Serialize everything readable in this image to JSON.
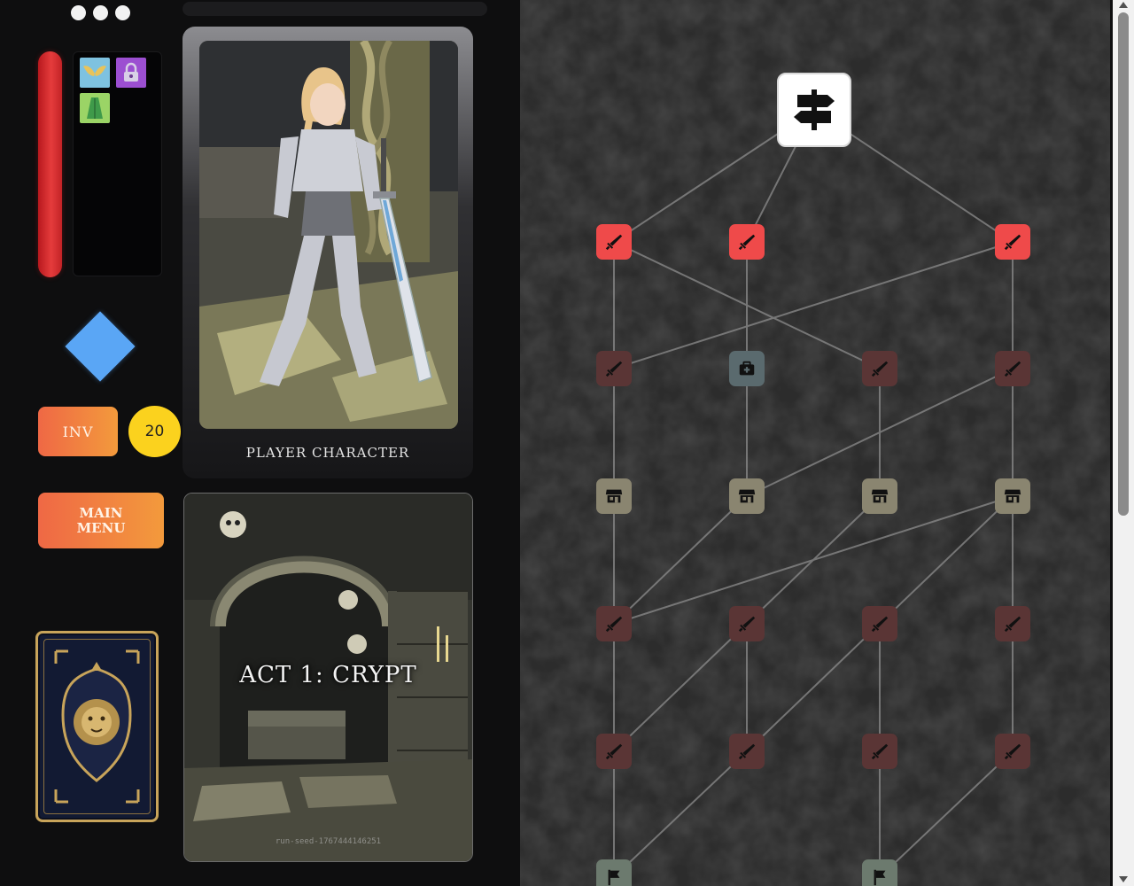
{
  "hud": {
    "inventory_label": "INV",
    "gold": "20",
    "main_menu_label": "MAIN\nMENU",
    "relics": [
      "wings-icon",
      "padlock-icon",
      "cloak-icon"
    ]
  },
  "character": {
    "label": "PLAYER CHARACTER"
  },
  "act": {
    "title": "ACT 1: CRYPT",
    "seed": "run-seed-1767444146251"
  },
  "map": {
    "boss_icon": "signpost-icon",
    "colors": {
      "combat_active": "#ef4a4a",
      "combat": "#5a3535",
      "rest": "#5a6a6e",
      "shop": "#8a8570",
      "end": "#6c7a6e",
      "path": "#8c8c8c"
    },
    "rows": [
      [
        "combat_active",
        "combat_active",
        null,
        "combat_active"
      ],
      [
        "combat",
        "rest",
        "combat",
        "combat"
      ],
      [
        "shop",
        "shop",
        "shop",
        "shop"
      ],
      [
        "combat",
        "combat",
        "combat",
        "combat"
      ],
      [
        "combat",
        "combat",
        "combat",
        "combat"
      ],
      [
        "end",
        null,
        "end",
        null
      ]
    ]
  }
}
